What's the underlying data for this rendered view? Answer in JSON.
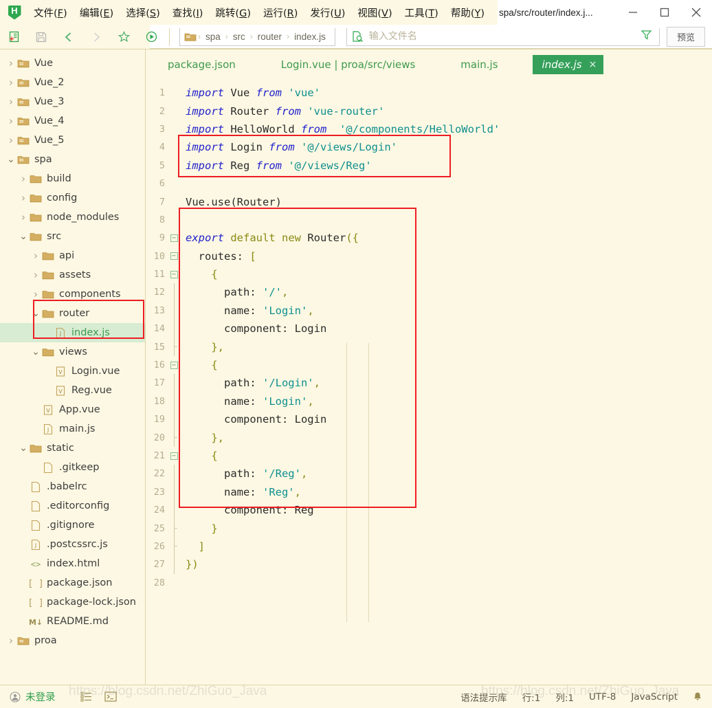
{
  "window": {
    "logo_letter": "H",
    "doc_title": "spa/src/router/index.j...",
    "minimize": "minimize-icon",
    "maximize": "maximize-icon",
    "close": "close-icon"
  },
  "menu": {
    "items": [
      {
        "text": "文件",
        "key": "F"
      },
      {
        "text": "编辑",
        "key": "E"
      },
      {
        "text": "选择",
        "key": "S"
      },
      {
        "text": "查找",
        "key": "I"
      },
      {
        "text": "跳转",
        "key": "G"
      },
      {
        "text": "运行",
        "key": "R"
      },
      {
        "text": "发行",
        "key": "U"
      },
      {
        "text": "视图",
        "key": "V"
      },
      {
        "text": "工具",
        "key": "T"
      },
      {
        "text": "帮助",
        "key": "Y"
      }
    ]
  },
  "toolbar": {
    "buttons": [
      "new-file-icon",
      "save-icon",
      "back-icon",
      "forward-icon",
      "favorite-icon",
      "run-icon"
    ],
    "breadcrumb": {
      "root_icon": "folder-icon",
      "crumbs": [
        "spa",
        "src",
        "router",
        "index.js"
      ],
      "separator": "›"
    },
    "search_placeholder": "输入文件名",
    "search_value": "",
    "search_icon": "file-search-icon",
    "filter_icon": "filter-icon",
    "preview_label": "预览"
  },
  "sidebar": {
    "items": [
      {
        "label": "Vue",
        "indent": 0,
        "type": "folder-open-outline",
        "arrow": "collapsed",
        "selected": false
      },
      {
        "label": "Vue_2",
        "indent": 0,
        "type": "folder-open-outline",
        "arrow": "collapsed",
        "selected": false
      },
      {
        "label": "Vue_3",
        "indent": 0,
        "type": "folder-open-outline",
        "arrow": "collapsed",
        "selected": false
      },
      {
        "label": "Vue_4",
        "indent": 0,
        "type": "folder-open-outline",
        "arrow": "collapsed",
        "selected": false
      },
      {
        "label": "Vue_5",
        "indent": 0,
        "type": "folder-open-outline",
        "arrow": "collapsed",
        "selected": false
      },
      {
        "label": "spa",
        "indent": 0,
        "type": "folder-open-outline",
        "arrow": "expanded",
        "selected": false
      },
      {
        "label": "build",
        "indent": 1,
        "type": "folder",
        "arrow": "collapsed",
        "selected": false
      },
      {
        "label": "config",
        "indent": 1,
        "type": "folder",
        "arrow": "collapsed",
        "selected": false
      },
      {
        "label": "node_modules",
        "indent": 1,
        "type": "folder",
        "arrow": "collapsed",
        "selected": false
      },
      {
        "label": "src",
        "indent": 1,
        "type": "folder",
        "arrow": "expanded",
        "selected": false
      },
      {
        "label": "api",
        "indent": 2,
        "type": "folder",
        "arrow": "collapsed",
        "selected": false
      },
      {
        "label": "assets",
        "indent": 2,
        "type": "folder",
        "arrow": "collapsed",
        "selected": false
      },
      {
        "label": "components",
        "indent": 2,
        "type": "folder",
        "arrow": "collapsed",
        "selected": false
      },
      {
        "label": "router",
        "indent": 2,
        "type": "folder",
        "arrow": "expanded",
        "selected": false
      },
      {
        "label": "index.js",
        "indent": 3,
        "type": "js",
        "arrow": "none",
        "selected": true
      },
      {
        "label": "views",
        "indent": 2,
        "type": "folder",
        "arrow": "expanded",
        "selected": false
      },
      {
        "label": "Login.vue",
        "indent": 3,
        "type": "vue",
        "arrow": "none",
        "selected": false
      },
      {
        "label": "Reg.vue",
        "indent": 3,
        "type": "vue",
        "arrow": "none",
        "selected": false
      },
      {
        "label": "App.vue",
        "indent": 2,
        "type": "vue",
        "arrow": "none",
        "selected": false
      },
      {
        "label": "main.js",
        "indent": 2,
        "type": "js",
        "arrow": "none",
        "selected": false
      },
      {
        "label": "static",
        "indent": 1,
        "type": "folder",
        "arrow": "expanded",
        "selected": false
      },
      {
        "label": ".gitkeep",
        "indent": 2,
        "type": "file",
        "arrow": "none",
        "selected": false
      },
      {
        "label": ".babelrc",
        "indent": 1,
        "type": "file",
        "arrow": "none",
        "selected": false
      },
      {
        "label": ".editorconfig",
        "indent": 1,
        "type": "file",
        "arrow": "none",
        "selected": false
      },
      {
        "label": ".gitignore",
        "indent": 1,
        "type": "file",
        "arrow": "none",
        "selected": false
      },
      {
        "label": ".postcssrc.js",
        "indent": 1,
        "type": "js",
        "arrow": "none",
        "selected": false
      },
      {
        "label": "index.html",
        "indent": 1,
        "type": "html",
        "arrow": "none",
        "selected": false
      },
      {
        "label": "package.json",
        "indent": 1,
        "type": "json",
        "arrow": "none",
        "selected": false
      },
      {
        "label": "package-lock.json",
        "indent": 1,
        "type": "json",
        "arrow": "none",
        "selected": false
      },
      {
        "label": "README.md",
        "indent": 1,
        "type": "md",
        "arrow": "none",
        "selected": false
      },
      {
        "label": "proa",
        "indent": 0,
        "type": "folder-open-outline",
        "arrow": "collapsed",
        "selected": false
      }
    ]
  },
  "tabs": [
    {
      "label": "package.json",
      "active": false,
      "closable": false
    },
    {
      "label": "Login.vue | proa/src/views",
      "active": false,
      "closable": false
    },
    {
      "label": "main.js",
      "active": false,
      "closable": false
    },
    {
      "label": "index.js",
      "active": true,
      "closable": true,
      "close_glyph": "×"
    }
  ],
  "code": {
    "lines": [
      {
        "n": 1,
        "fold": "none",
        "guide": 0,
        "tokens": [
          {
            "t": "import",
            "c": "k"
          },
          {
            "t": " Vue ",
            "c": "id"
          },
          {
            "t": "from",
            "c": "k"
          },
          {
            "t": " ",
            "c": "id"
          },
          {
            "t": "'vue'",
            "c": "str"
          }
        ]
      },
      {
        "n": 2,
        "fold": "none",
        "guide": 0,
        "tokens": [
          {
            "t": "import",
            "c": "k"
          },
          {
            "t": " Router ",
            "c": "id"
          },
          {
            "t": "from",
            "c": "k"
          },
          {
            "t": " ",
            "c": "id"
          },
          {
            "t": "'vue-router'",
            "c": "str"
          }
        ]
      },
      {
        "n": 3,
        "fold": "none",
        "guide": 0,
        "tokens": [
          {
            "t": "import",
            "c": "k"
          },
          {
            "t": " HelloWorld ",
            "c": "id"
          },
          {
            "t": "from",
            "c": "k"
          },
          {
            "t": "  ",
            "c": "id"
          },
          {
            "t": "'@/components/HelloWorld'",
            "c": "str"
          }
        ]
      },
      {
        "n": 4,
        "fold": "none",
        "guide": 0,
        "tokens": [
          {
            "t": "import",
            "c": "k"
          },
          {
            "t": " Login ",
            "c": "id"
          },
          {
            "t": "from",
            "c": "k"
          },
          {
            "t": " ",
            "c": "id"
          },
          {
            "t": "'@/views/Login'",
            "c": "str"
          }
        ]
      },
      {
        "n": 5,
        "fold": "none",
        "guide": 0,
        "tokens": [
          {
            "t": "import",
            "c": "k"
          },
          {
            "t": " Reg ",
            "c": "id"
          },
          {
            "t": "from",
            "c": "k"
          },
          {
            "t": " ",
            "c": "id"
          },
          {
            "t": "'@/views/Reg'",
            "c": "str"
          }
        ]
      },
      {
        "n": 6,
        "fold": "none",
        "guide": 0,
        "tokens": []
      },
      {
        "n": 7,
        "fold": "none",
        "guide": 0,
        "tokens": [
          {
            "t": "Vue.use(Router)",
            "c": "id"
          }
        ]
      },
      {
        "n": 8,
        "fold": "none",
        "guide": 0,
        "tokens": []
      },
      {
        "n": 9,
        "fold": "open",
        "guide": 0,
        "tokens": [
          {
            "t": "export",
            "c": "k"
          },
          {
            "t": " ",
            "c": "id"
          },
          {
            "t": "default",
            "c": "kw2"
          },
          {
            "t": " ",
            "c": "id"
          },
          {
            "t": "new",
            "c": "kw2"
          },
          {
            "t": " Router",
            "c": "id"
          },
          {
            "t": "({",
            "c": "pun"
          }
        ]
      },
      {
        "n": 10,
        "fold": "open",
        "guide": 0,
        "tokens": [
          {
            "t": "  routes: ",
            "c": "id"
          },
          {
            "t": "[",
            "c": "pun"
          }
        ]
      },
      {
        "n": 11,
        "fold": "open",
        "guide": 1,
        "tokens": [
          {
            "t": "    ",
            "c": "id"
          },
          {
            "t": "{",
            "c": "pun"
          }
        ]
      },
      {
        "n": 12,
        "fold": "line",
        "guide": 2,
        "tokens": [
          {
            "t": "      path: ",
            "c": "id"
          },
          {
            "t": "'/'",
            "c": "str"
          },
          {
            "t": ",",
            "c": "pun"
          }
        ]
      },
      {
        "n": 13,
        "fold": "line",
        "guide": 2,
        "tokens": [
          {
            "t": "      name: ",
            "c": "id"
          },
          {
            "t": "'Login'",
            "c": "str"
          },
          {
            "t": ",",
            "c": "pun"
          }
        ]
      },
      {
        "n": 14,
        "fold": "line",
        "guide": 2,
        "tokens": [
          {
            "t": "      component: Login",
            "c": "id"
          }
        ]
      },
      {
        "n": 15,
        "fold": "endl",
        "guide": 1,
        "tokens": [
          {
            "t": "    ",
            "c": "id"
          },
          {
            "t": "},",
            "c": "pun"
          }
        ]
      },
      {
        "n": 16,
        "fold": "open",
        "guide": 1,
        "tokens": [
          {
            "t": "    ",
            "c": "id"
          },
          {
            "t": "{",
            "c": "pun"
          }
        ]
      },
      {
        "n": 17,
        "fold": "line",
        "guide": 2,
        "tokens": [
          {
            "t": "      path: ",
            "c": "id"
          },
          {
            "t": "'/Login'",
            "c": "str"
          },
          {
            "t": ",",
            "c": "pun"
          }
        ]
      },
      {
        "n": 18,
        "fold": "line",
        "guide": 2,
        "tokens": [
          {
            "t": "      name: ",
            "c": "id"
          },
          {
            "t": "'Login'",
            "c": "str"
          },
          {
            "t": ",",
            "c": "pun"
          }
        ]
      },
      {
        "n": 19,
        "fold": "line",
        "guide": 2,
        "tokens": [
          {
            "t": "      component: Login",
            "c": "id"
          }
        ]
      },
      {
        "n": 20,
        "fold": "endl",
        "guide": 1,
        "tokens": [
          {
            "t": "    ",
            "c": "id"
          },
          {
            "t": "},",
            "c": "pun"
          }
        ]
      },
      {
        "n": 21,
        "fold": "open",
        "guide": 1,
        "tokens": [
          {
            "t": "    ",
            "c": "id"
          },
          {
            "t": "{",
            "c": "pun"
          }
        ]
      },
      {
        "n": 22,
        "fold": "line",
        "guide": 2,
        "tokens": [
          {
            "t": "      path: ",
            "c": "id"
          },
          {
            "t": "'/Reg'",
            "c": "str"
          },
          {
            "t": ",",
            "c": "pun"
          }
        ]
      },
      {
        "n": 23,
        "fold": "line",
        "guide": 2,
        "tokens": [
          {
            "t": "      name: ",
            "c": "id"
          },
          {
            "t": "'Reg'",
            "c": "str"
          },
          {
            "t": ",",
            "c": "pun"
          }
        ]
      },
      {
        "n": 24,
        "fold": "line",
        "guide": 2,
        "tokens": [
          {
            "t": "      component: Reg",
            "c": "id"
          }
        ]
      },
      {
        "n": 25,
        "fold": "endl",
        "guide": 1,
        "tokens": [
          {
            "t": "    ",
            "c": "id"
          },
          {
            "t": "}",
            "c": "pun"
          }
        ]
      },
      {
        "n": 26,
        "fold": "endl",
        "guide": 0,
        "tokens": [
          {
            "t": "  ",
            "c": "id"
          },
          {
            "t": "]",
            "c": "pun"
          }
        ]
      },
      {
        "n": 27,
        "fold": "line0",
        "guide": 0,
        "tokens": [
          {
            "t": "})",
            "c": "pun"
          }
        ]
      },
      {
        "n": 28,
        "fold": "none",
        "guide": 0,
        "tokens": []
      }
    ]
  },
  "statusbar": {
    "user": "未登录",
    "user_icon": "account-icon",
    "outline_icon": "outline-icon",
    "terminal_icon": "terminal-icon",
    "syntax_lib": "语法提示库",
    "line": "行:1",
    "column": "列:1",
    "encoding": "UTF-8",
    "language": "JavaScript",
    "bell_icon": "bell-icon"
  },
  "watermark": {
    "text1": "https://blog.csdn.net/ZhiGuo_Java",
    "text2": "https://blog.csdn.net/ZhiGuo_Java"
  },
  "colors": {
    "accent_green": "#35a05a",
    "bg_cream": "#fdf8e3",
    "selection": "#d7ecd2",
    "annotation_red": "#ee1c23"
  }
}
